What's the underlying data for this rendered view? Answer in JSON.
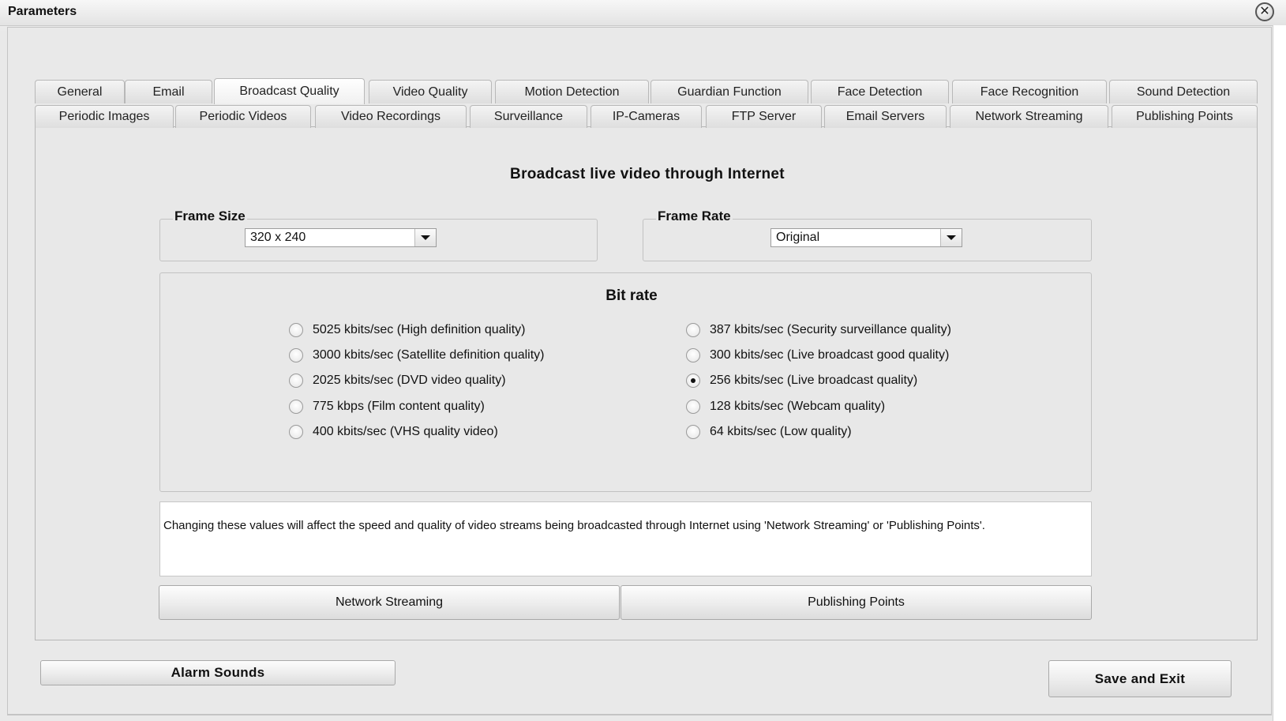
{
  "window": {
    "title": "Parameters",
    "close_icon": "close-icon"
  },
  "tabs": {
    "row1": [
      "General",
      "Email",
      "Broadcast Quality",
      "Video Quality",
      "Motion Detection",
      "Guardian Function",
      "Face Detection",
      "Face Recognition",
      "Sound Detection"
    ],
    "row2": [
      "Periodic Images",
      "Periodic Videos",
      "Video Recordings",
      "Surveillance",
      "IP-Cameras",
      "FTP Server",
      "Email Servers",
      "Network Streaming",
      "Publishing Points"
    ],
    "active": "Broadcast Quality"
  },
  "panel": {
    "heading": "Broadcast live video through Internet",
    "frame_size": {
      "legend": "Frame Size",
      "value": "320 x 240"
    },
    "frame_rate": {
      "legend": "Frame Rate",
      "value": "Original"
    },
    "bitrate": {
      "heading": "Bit rate",
      "left_options": [
        "5025 kbits/sec (High definition quality)",
        "3000 kbits/sec (Satellite definition quality)",
        "2025 kbits/sec (DVD video quality)",
        "775 kbps (Film content quality)",
        "400 kbits/sec (VHS quality video)"
      ],
      "right_options": [
        "387 kbits/sec (Security surveillance quality)",
        "300 kbits/sec (Live broadcast good quality)",
        "256 kbits/sec (Live broadcast quality)",
        "128 kbits/sec (Webcam quality)",
        "64 kbits/sec (Low quality)"
      ],
      "selected": "256 kbits/sec (Live broadcast quality)"
    },
    "info_text": "Changing these values will affect the speed and quality of video streams being broadcasted through Internet using 'Network Streaming' or 'Publishing Points'.",
    "network_streaming_button": "Network Streaming",
    "publishing_points_button": "Publishing Points"
  },
  "footer": {
    "alarm_sounds_button": "Alarm Sounds",
    "save_exit_button": "Save and Exit"
  }
}
